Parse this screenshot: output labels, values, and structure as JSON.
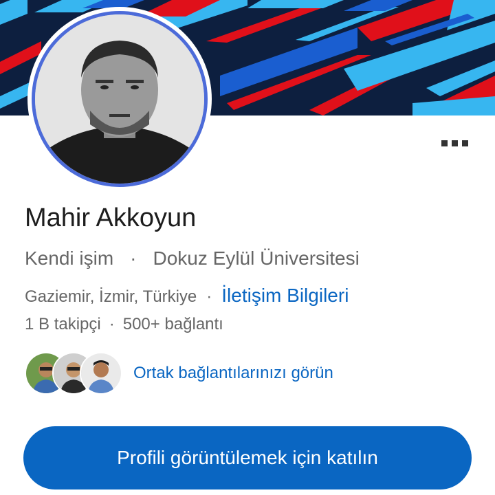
{
  "profile": {
    "name": "Mahir Akkoyun",
    "headline_company": "Kendi işim",
    "headline_separator": "·",
    "headline_school": "Dokuz Eylül Üniversitesi",
    "location": "Gaziemir, İzmir, Türkiye",
    "location_separator": "·",
    "contact_link": "İletişim Bilgileri",
    "followers": "1 B takipçi",
    "stats_separator": "·",
    "connections": "500+ bağlantı",
    "mutual_connections_link": "Ortak bağlantılarınızı görün",
    "avatar_icon": "profile-photo",
    "more_icon": "more-options-icon"
  },
  "actions": {
    "join_button_label": "Profili görüntülemek için katılın"
  },
  "colors": {
    "banner_dark": "#0d1f3f",
    "banner_red": "#e0101a",
    "banner_cyan": "#37b6f0",
    "banner_blue": "#1a5ed0",
    "link_blue": "#0a66c2",
    "button_blue": "#0a66c2",
    "avatar_ring": "#4c6bd9"
  }
}
